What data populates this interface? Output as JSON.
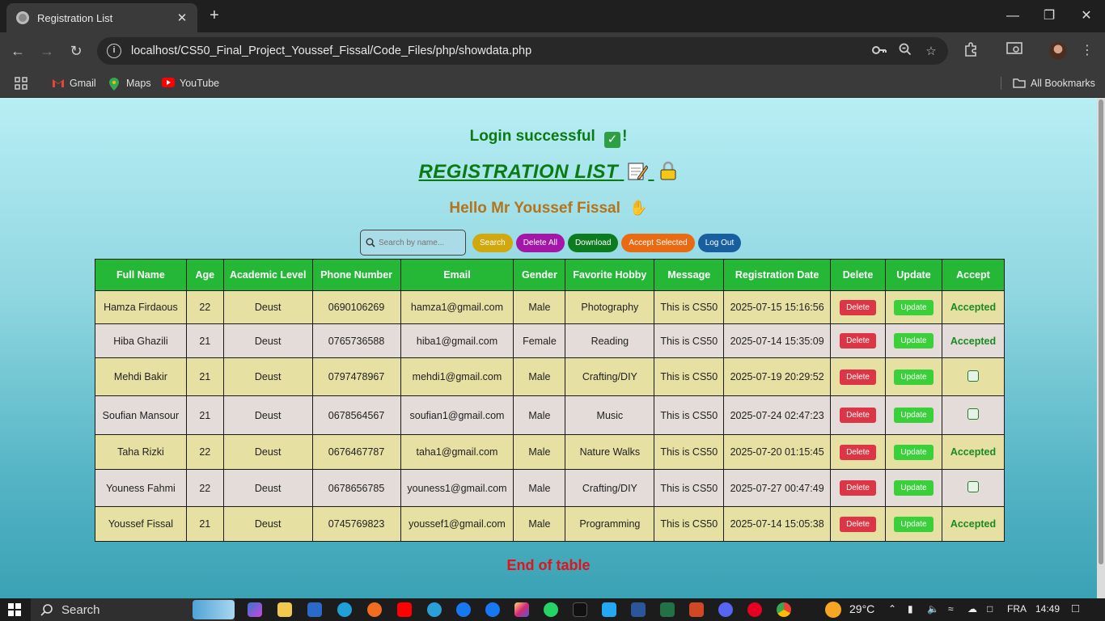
{
  "browser": {
    "tab_title": "Registration List",
    "tab_close": "✕",
    "new_tab": "+",
    "url": "localhost/CS50_Final_Project_Youssef_Fissal/Code_Files/php/showdata.php",
    "bookmarks": [
      "Gmail",
      "Maps",
      "YouTube"
    ],
    "all_bookmarks": "All Bookmarks"
  },
  "page": {
    "login_message": "Login successful",
    "login_suffix": "!",
    "title": "REGISTRATION LIST",
    "greeting": "Hello Mr Youssef Fissal",
    "end_text": "End of table"
  },
  "controls": {
    "search_placeholder": "Search by name...",
    "search_label": "Search",
    "delete_all_label": "Delete All",
    "download_label": "Download",
    "accept_selected_label": "Accept Selected",
    "logout_label": "Log Out"
  },
  "table": {
    "headers": [
      "Full Name",
      "Age",
      "Academic Level",
      "Phone Number",
      "Email",
      "Gender",
      "Favorite Hobby",
      "Message",
      "Registration Date",
      "Delete",
      "Update",
      "Accept"
    ],
    "delete_label": "Delete",
    "update_label": "Update",
    "accepted_label": "Accepted",
    "rows": [
      {
        "name": "Hamza Firdaous",
        "age": "22",
        "level": "Deust",
        "phone": "0690106269",
        "email": "hamza1@gmail.com",
        "gender": "Male",
        "hobby": "Photography",
        "message": "This is CS50",
        "date": "2025-07-15 15:16:56",
        "accepted": true
      },
      {
        "name": "Hiba Ghazili",
        "age": "21",
        "level": "Deust",
        "phone": "0765736588",
        "email": "hiba1@gmail.com",
        "gender": "Female",
        "hobby": "Reading",
        "message": "This is CS50",
        "date": "2025-07-14 15:35:09",
        "accepted": true
      },
      {
        "name": "Mehdi Bakir",
        "age": "21",
        "level": "Deust",
        "phone": "0797478967",
        "email": "mehdi1@gmail.com",
        "gender": "Male",
        "hobby": "Crafting/DIY",
        "message": "This is CS50",
        "date": "2025-07-19 20:29:52",
        "accepted": false
      },
      {
        "name": "Soufian Mansour",
        "age": "21",
        "level": "Deust",
        "phone": "0678564567",
        "email": "soufian1@gmail.com",
        "gender": "Male",
        "hobby": "Music",
        "message": "This is CS50",
        "date": "2025-07-24 02:47:23",
        "accepted": false
      },
      {
        "name": "Taha Rizki",
        "age": "22",
        "level": "Deust",
        "phone": "0676467787",
        "email": "taha1@gmail.com",
        "gender": "Male",
        "hobby": "Nature Walks",
        "message": "This is CS50",
        "date": "2025-07-20 01:15:45",
        "accepted": true
      },
      {
        "name": "Youness Fahmi",
        "age": "22",
        "level": "Deust",
        "phone": "0678656785",
        "email": "youness1@gmail.com",
        "gender": "Male",
        "hobby": "Crafting/DIY",
        "message": "This is CS50",
        "date": "2025-07-27 00:47:49",
        "accepted": false
      },
      {
        "name": "Youssef Fissal",
        "age": "21",
        "level": "Deust",
        "phone": "0745769823",
        "email": "youssef1@gmail.com",
        "gender": "Male",
        "hobby": "Programming",
        "message": "This is CS50",
        "date": "2025-07-14 15:05:38",
        "accepted": true
      }
    ]
  },
  "taskbar": {
    "search": "Search",
    "weather": "29°C",
    "lang": "FRA",
    "time": "14:49"
  },
  "colors": {
    "header_green": "#25b736",
    "odd_row": "#e6e0a3",
    "even_row": "#e3dcd8",
    "delete_red": "#dc3545",
    "update_green": "#39d03a"
  }
}
